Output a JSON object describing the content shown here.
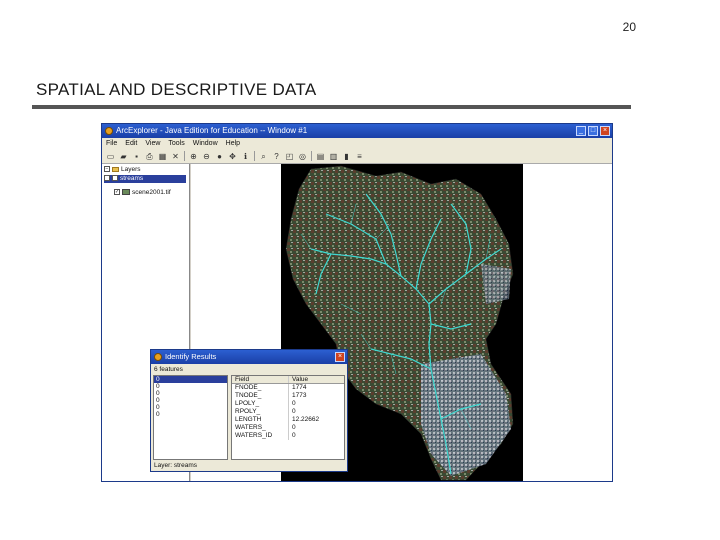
{
  "slide": {
    "number": "20",
    "title": "SPATIAL AND DESCRIPTIVE DATA"
  },
  "app": {
    "title": "ArcExplorer - Java Edition for Education -- Window #1",
    "window_controls": [
      "_",
      "□",
      "×"
    ],
    "menu": [
      "File",
      "Edit",
      "View",
      "Tools",
      "Window",
      "Help"
    ],
    "toolbar_icons": [
      "new-icon",
      "open-icon",
      "save-icon",
      "print-icon",
      "add-layer-icon",
      "remove-layer-icon",
      "zoom-in-icon",
      "zoom-out-icon",
      "globe-icon",
      "pan-icon",
      "identify-icon",
      "find-icon",
      "query-icon",
      "select-icon",
      "buffer-icon",
      "clear-selection-icon",
      "table-icon",
      "chart-icon",
      "properties-icon"
    ],
    "toolbar_glyphs": [
      "▭",
      "▰",
      "▪",
      "⎙",
      "▦",
      "✕",
      "⊕",
      "⊖",
      "●",
      "✥",
      "ℹ",
      "⌕",
      "?",
      "◰",
      "◎",
      "▤",
      "▥",
      "▮",
      "≡"
    ]
  },
  "toc": {
    "root_label": "Layers",
    "layers": [
      {
        "label": "streams",
        "checked": true,
        "selected": true
      },
      {
        "label": "scene2001.tif",
        "checked": true,
        "selected": false
      }
    ]
  },
  "identify": {
    "title": "Identify Results",
    "count_text": "6 features",
    "features": [
      "0",
      "0",
      "0",
      "0",
      "0",
      "0"
    ],
    "columns": [
      "Field",
      "Value"
    ],
    "rows": [
      {
        "field": "FNODE_",
        "value": "1774"
      },
      {
        "field": "TNODE_",
        "value": "1773"
      },
      {
        "field": "LPOLY_",
        "value": "0"
      },
      {
        "field": "RPOLY_",
        "value": "0"
      },
      {
        "field": "LENGTH",
        "value": "12.22662"
      },
      {
        "field": "WATERS_",
        "value": "0"
      },
      {
        "field": "WATERS_ID",
        "value": "0"
      }
    ],
    "layer_text": "Layer: streams"
  },
  "colors": {
    "title_blue": "#1a3fa6",
    "stream": "#3fd8d0",
    "terrain_dark": "#2e3f2a",
    "terrain_brown": "#6b4a35"
  }
}
